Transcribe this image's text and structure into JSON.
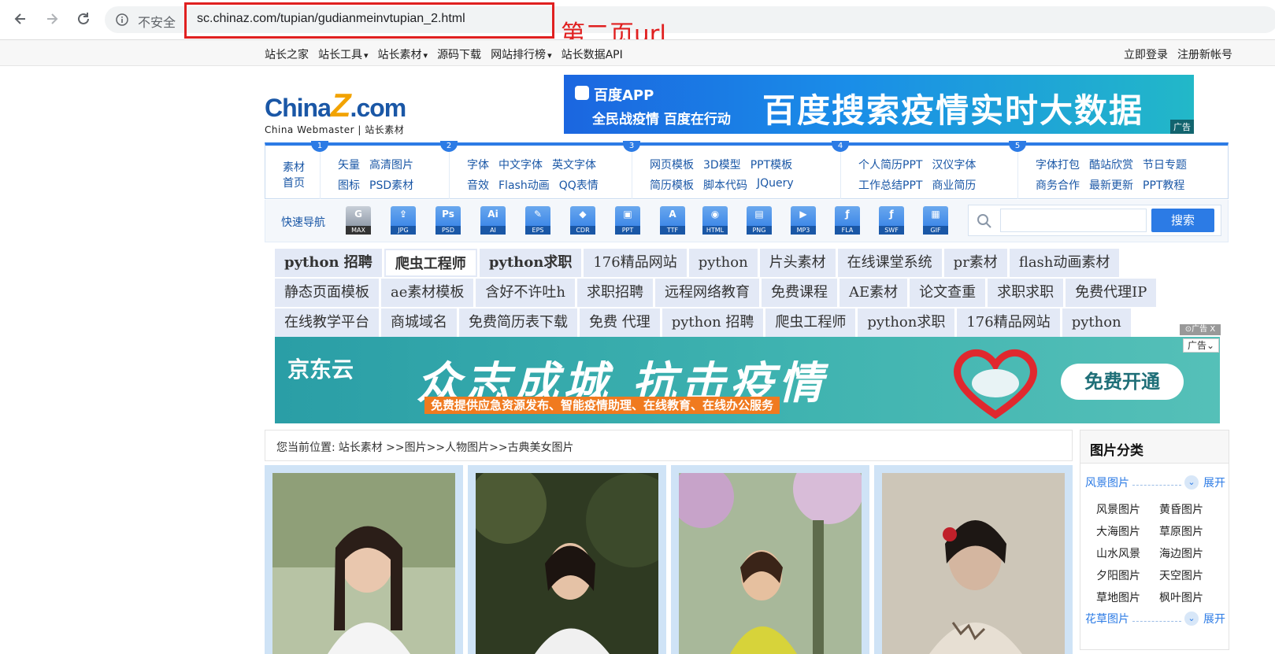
{
  "browser": {
    "insecure_label": "不安全",
    "url": "sc.chinaz.com/tupian/gudianmeinvtupian_2.html",
    "annotation": "第二页url"
  },
  "topnav": {
    "links": [
      "站长之家",
      "站长工具",
      "站长素材",
      "源码下载",
      "网站排行榜",
      "站长数据API"
    ],
    "dropdown_flags": [
      false,
      true,
      true,
      false,
      true,
      false
    ],
    "login": "立即登录",
    "register": "注册新帐号"
  },
  "logo": {
    "brand_a": "China",
    "brand_z": "Z",
    "brand_b": ".com",
    "subtitle": "China Webmaster | 站长素材"
  },
  "baidu_ad": {
    "app": "百度APP",
    "slogan": "全民战疫情 百度在行动",
    "headline": "百度搜索疫情实时大数据",
    "ad_label": "广告"
  },
  "catnav": {
    "home": [
      "素材",
      "首页"
    ],
    "groups": [
      {
        "num": "1",
        "row1": [
          "矢量",
          "高清图片"
        ],
        "row2": [
          "图标",
          "PSD素材"
        ]
      },
      {
        "num": "2",
        "row1": [
          "字体",
          "中文字体",
          "英文字体"
        ],
        "row2": [
          "音效",
          "Flash动画",
          "QQ表情"
        ]
      },
      {
        "num": "3",
        "row1": [
          "网页模板",
          "3D模型",
          "PPT模板"
        ],
        "row2": [
          "简历模板",
          "脚本代码",
          "JQuery"
        ]
      },
      {
        "num": "4",
        "row1": [
          "个人简历PPT",
          "汉仪字体"
        ],
        "row2": [
          "工作总结PPT",
          "商业简历"
        ]
      },
      {
        "num": "5",
        "row1": [
          "字体打包",
          "酷站欣赏",
          "节日专题"
        ],
        "row2": [
          "商务合作",
          "最新更新",
          "PPT教程"
        ]
      }
    ]
  },
  "quicknav": {
    "label": "快速导航",
    "icons": [
      {
        "glyph": "G",
        "ext": "MAX"
      },
      {
        "glyph": "⇪",
        "ext": "JPG"
      },
      {
        "glyph": "Ps",
        "ext": "PSD"
      },
      {
        "glyph": "Ai",
        "ext": "AI"
      },
      {
        "glyph": "✎",
        "ext": "EPS"
      },
      {
        "glyph": "◆",
        "ext": "CDR"
      },
      {
        "glyph": "▣",
        "ext": "PPT"
      },
      {
        "glyph": "A",
        "ext": "TTF"
      },
      {
        "glyph": "◉",
        "ext": "HTML"
      },
      {
        "glyph": "▤",
        "ext": "PNG"
      },
      {
        "glyph": "▶",
        "ext": "MP3"
      },
      {
        "glyph": "ƒ",
        "ext": "FLA"
      },
      {
        "glyph": "ƒ",
        "ext": "SWF"
      },
      {
        "glyph": "▦",
        "ext": "GIF"
      }
    ],
    "search_placeholder": "",
    "search_button": "搜索"
  },
  "tags": {
    "row1": [
      "python 招聘",
      "爬虫工程师",
      "python求职",
      "176精品网站",
      "python",
      "片头素材",
      "在线课堂系统",
      "pr素材",
      "flash动画素材"
    ],
    "row2": [
      "静态页面模板",
      "ae素材模板",
      "含好不许吐h",
      "求职招聘",
      "远程网络教育",
      "免费课程",
      "AE素材",
      "论文查重",
      "求职求职",
      "免费代理IP"
    ],
    "row3": [
      "在线教学平台",
      "商城域名",
      "免费简历表下载",
      "免费 代理",
      "python 招聘",
      "爬虫工程师",
      "python求职",
      "176精品网站",
      "python"
    ],
    "ad_close": "⊙广告 X",
    "ad_drop": "广告⌄"
  },
  "jd_ad": {
    "logo": "京东云",
    "headline": "众志成城 抗击疫情",
    "strip": "免费提供应急资源发布、智能疫情助理、在线教育、在线办公服务",
    "cta": "免费开通"
  },
  "breadcrumb": {
    "prefix": "您当前位置:",
    "path": "站长素材 >>图片>>人物图片>>古典美女图片"
  },
  "sidebar": {
    "title": "图片分类",
    "section1": "风景图片",
    "section2": "花草图片",
    "expand": "展开",
    "links": [
      "风景图片",
      "黄昏图片",
      "大海图片",
      "草原图片",
      "山水风景",
      "海边图片",
      "夕阳图片",
      "天空图片",
      "草地图片",
      "枫叶图片"
    ]
  },
  "colors": {
    "brand_blue": "#2c7be5",
    "annotation_red": "#e02020",
    "tag_bg": "#e3e9f6"
  }
}
